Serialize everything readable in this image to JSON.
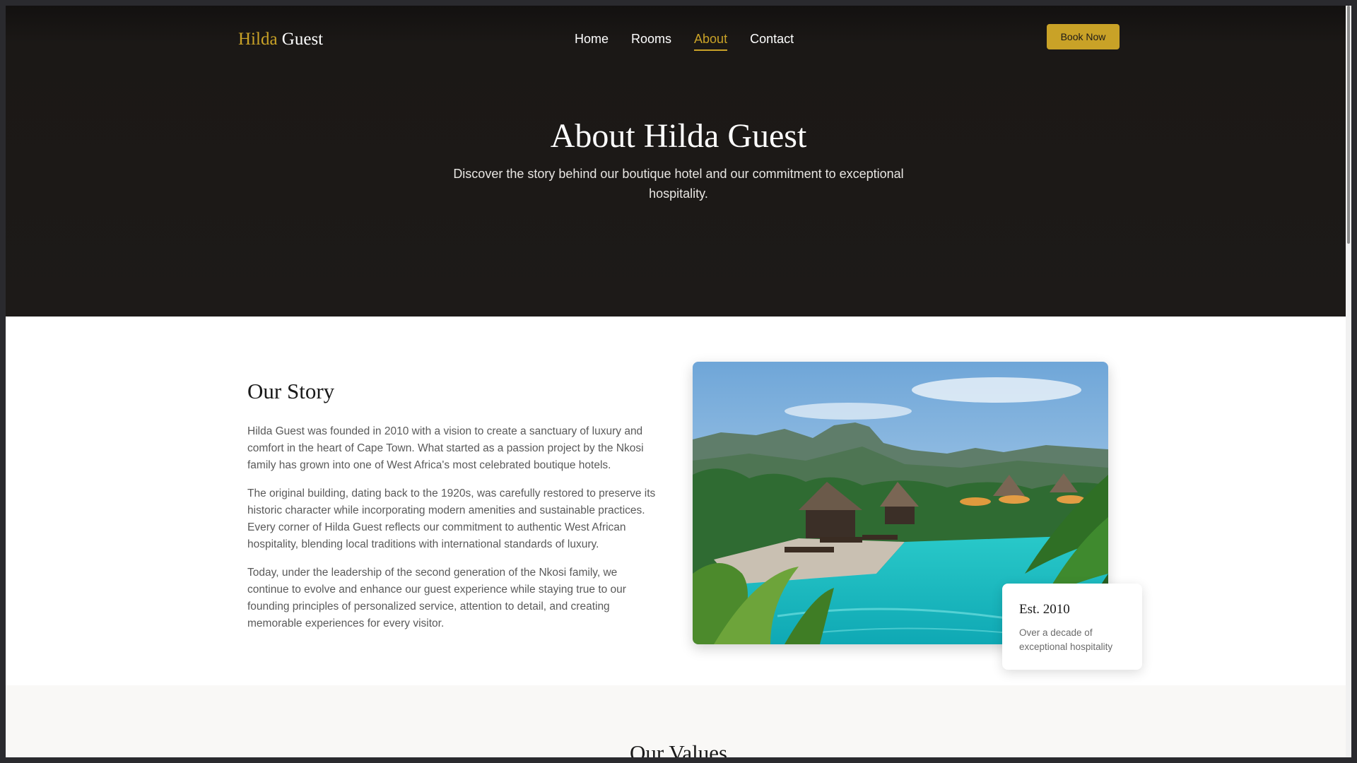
{
  "brand": {
    "name_part1": "Hilda",
    "name_part2": "Guest",
    "accent_color": "#c9a227"
  },
  "nav": {
    "items": [
      {
        "label": "Home",
        "active": false
      },
      {
        "label": "Rooms",
        "active": false
      },
      {
        "label": "About",
        "active": true
      },
      {
        "label": "Contact",
        "active": false
      }
    ],
    "cta_label": "Book Now"
  },
  "hero": {
    "title": "About Hilda Guest",
    "subtitle": "Discover the story behind our boutique hotel and our commitment to exceptional hospitality."
  },
  "story": {
    "title": "Our Story",
    "paragraphs": [
      "Hilda Guest was founded in 2010 with a vision to create a sanctuary of luxury and comfort in the heart of Cape Town. What started as a passion project by the Nkosi family has grown into one of West Africa's most celebrated boutique hotels.",
      "The original building, dating back to the 1920s, was carefully restored to preserve its historic character while incorporating modern amenities and sustainable practices. Every corner of Hilda Guest reflects our commitment to authentic West African hospitality, blending local traditions with international standards of luxury.",
      "Today, under the leadership of the second generation of the Nkosi family, we continue to evolve and enhance our guest experience while staying true to our founding principles of personalized service, attention to detail, and creating memorable experiences for every visitor."
    ],
    "image_icon": "resort-pool-photo",
    "badge": {
      "title": "Est. 2010",
      "subtitle": "Over a decade of exceptional hospitality"
    }
  },
  "values": {
    "title": "Our Values"
  }
}
